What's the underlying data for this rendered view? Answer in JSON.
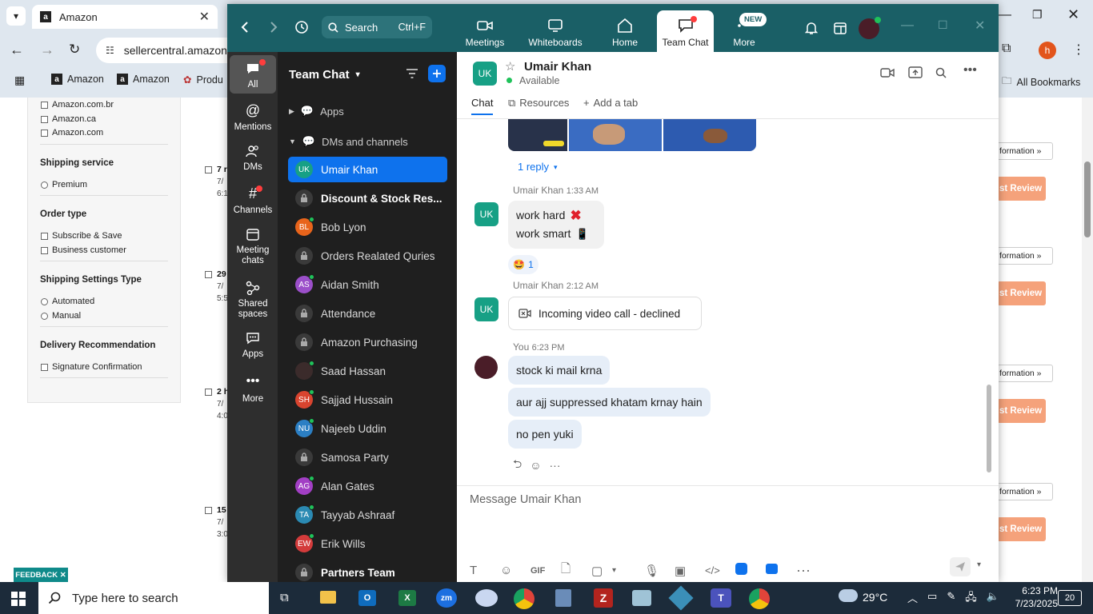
{
  "browser": {
    "tab_title": "Amazon",
    "url": "sellercentral.amazon",
    "bookmarks": [
      "Amazon",
      "Amazon",
      "Produ"
    ],
    "all_bookmarks": "All Bookmarks",
    "profile_initial": "h"
  },
  "seller": {
    "marketplaces": [
      "Amazon.com.br",
      "Amazon.ca",
      "Amazon.com"
    ],
    "shipping_service": {
      "title": "Shipping service",
      "options": [
        "Premium"
      ]
    },
    "order_type": {
      "title": "Order type",
      "options": [
        "Subscribe & Save",
        "Business customer"
      ]
    },
    "shipping_settings": {
      "title": "Shipping Settings Type",
      "options": [
        "Automated",
        "Manual"
      ]
    },
    "delivery": {
      "title": "Delivery Recommendation",
      "options": [
        "Signature Confirmation"
      ]
    },
    "rows": [
      {
        "t1": "7 r",
        "t2": "7/",
        "t3": "6:1"
      },
      {
        "t1": "29",
        "t2": "7/",
        "t3": "5:5"
      },
      {
        "t1": "2 h",
        "t2": "7/",
        "t3": "4:0"
      },
      {
        "t1": "15",
        "t2": "7/",
        "t3": "3:0"
      }
    ],
    "info_label": "formation »",
    "review_label": "st Review",
    "feedback": "FEEDBACK ✕"
  },
  "zoom": {
    "search_placeholder": "Search",
    "search_shortcut": "Ctrl+F",
    "top_tabs": [
      "Meetings",
      "Whiteboards",
      "Home",
      "Team Chat",
      "More"
    ],
    "new_badge": "NEW",
    "rail": [
      "All",
      "Mentions",
      "DMs",
      "Channels",
      "Meeting chats",
      "Shared spaces",
      "Apps",
      "More"
    ],
    "list_title": "Team Chat",
    "sections": [
      "Apps",
      "DMs and channels"
    ],
    "items": [
      {
        "name": "Umair Khan",
        "initials": "UK",
        "color": "#17a085"
      },
      {
        "name": "Discount & Stock Res...",
        "initials": "",
        "color": ""
      },
      {
        "name": "Bob Lyon",
        "initials": "BL",
        "color": "#e8641b"
      },
      {
        "name": "Orders Realated Quries",
        "initials": "",
        "color": ""
      },
      {
        "name": "Aidan Smith",
        "initials": "AS",
        "color": "#9b4fc9"
      },
      {
        "name": "Attendance",
        "initials": "",
        "color": ""
      },
      {
        "name": "Amazon Purchasing",
        "initials": "",
        "color": ""
      },
      {
        "name": "Saad Hassan",
        "initials": "",
        "color": "#3b2b2b"
      },
      {
        "name": "Sajjad Hussain",
        "initials": "SH",
        "color": "#d9442f"
      },
      {
        "name": "Najeeb Uddin",
        "initials": "NU",
        "color": "#2b7fc4"
      },
      {
        "name": "Samosa Party",
        "initials": "",
        "color": ""
      },
      {
        "name": "Alan Gates",
        "initials": "AG",
        "color": "#a23fc4"
      },
      {
        "name": "Tayyab Ashraaf",
        "initials": "TA",
        "color": "#2b8ab3"
      },
      {
        "name": "Erik Wills",
        "initials": "EW",
        "color": "#d33b3b"
      },
      {
        "name": "Partners Team",
        "initials": "",
        "color": ""
      }
    ],
    "chat": {
      "contact": "Umair Khan",
      "contact_initials": "UK",
      "status": "Available",
      "tabs": [
        "Chat",
        "Resources",
        "Add a tab"
      ],
      "reply": "1 reply",
      "msg1_meta_name": "Umair Khan",
      "msg1_meta_time": "1:33 AM",
      "msg1_line1": "work hard",
      "msg1_line2": "work smart",
      "reaction_count": "1",
      "msg2_meta_name": "Umair Khan",
      "msg2_meta_time": "2:12 AM",
      "call_text": "Incoming video call - declined",
      "msg3_meta_name": "You",
      "msg3_meta_time": "6:23 PM",
      "my_msgs": [
        "stock ki mail krna",
        "aur ajj suppressed khatam krnay hain",
        "no pen yuki"
      ],
      "composer_placeholder": "Message Umair Khan",
      "gif_label": "GIF"
    }
  },
  "taskbar": {
    "search_placeholder": "Type here to search",
    "weather": "29°C",
    "time": "6:23 PM",
    "date": "7/23/2025",
    "notifications": "20"
  }
}
